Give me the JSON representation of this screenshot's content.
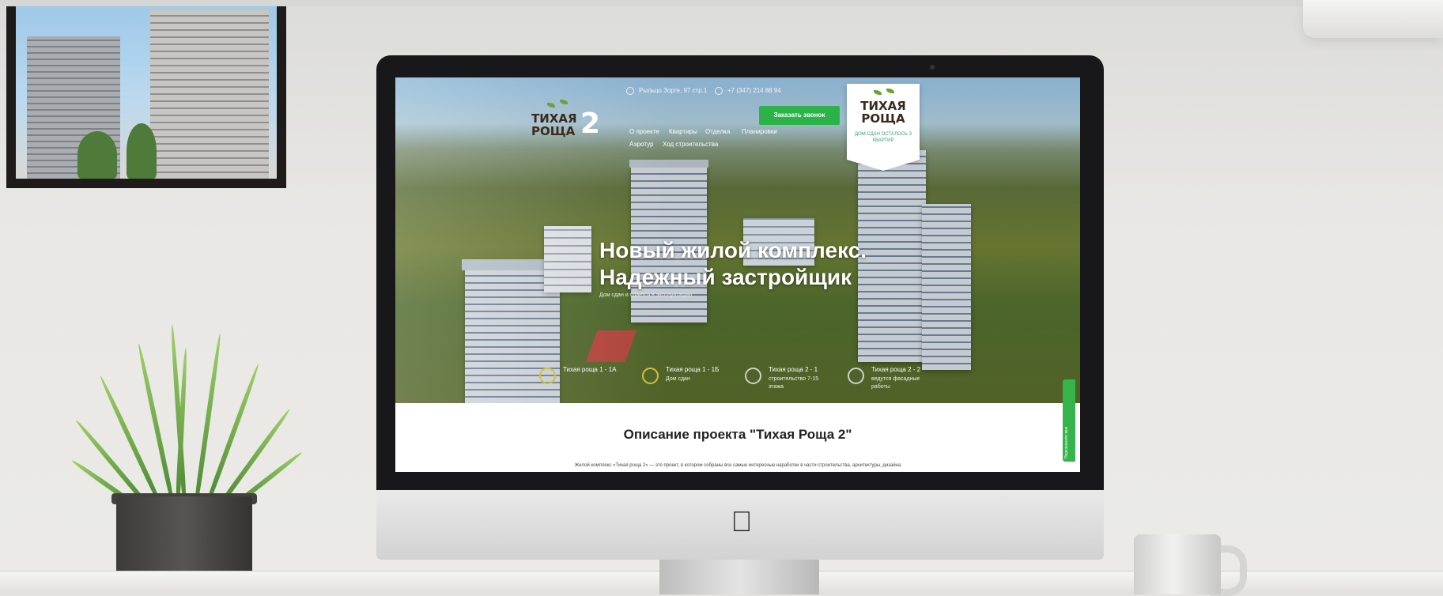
{
  "screen": {
    "topbar": {
      "address": "Рыльцо Зорге, 97 стр.1",
      "phone": "+7 (347) 214 88 94",
      "call_button": "Заказать звонок"
    },
    "logo": {
      "line1": "ТИХАЯ",
      "line2": "РОЩА",
      "number": "2"
    },
    "badge": {
      "line1": "ТИХАЯ",
      "line2": "РОЩА",
      "subtitle": "ДОМ СДАН ОСТАЛОСЬ 3 КВАРТИР"
    },
    "nav": [
      "О проекте",
      "Квартиры",
      "Отделка",
      "Планировки",
      "Аэротур",
      "Ход строительства"
    ],
    "hero": {
      "headline_1": "Новый жилой комплекс.",
      "headline_2": "Надежный застройщик",
      "subline": "Дом сдан и сдается в эксплуатацию"
    },
    "steps": [
      {
        "title": "Тихая роща 1 - 1А",
        "desc": ""
      },
      {
        "title": "Тихая роща 1 - 1Б",
        "desc": "Дом сдан"
      },
      {
        "title": "Тихая роща 2 - 1",
        "desc": "строительство 7-15 этажа"
      },
      {
        "title": "Тихая роща 2 - 2",
        "desc": "ведутся фасадные работы"
      }
    ],
    "side_tab": "Перезвоните мне",
    "description": {
      "title": "Описание проекта \"Тихая Роща 2\"",
      "text": "Жилой комплекс «Тихая роща 2» — это проект, в котором собраны все самые интересные наработки в части строительства, архитектуры, дизайна"
    }
  },
  "colors": {
    "accent_green": "#2bb34a",
    "ring_yellow": "#d1c03c",
    "logo_brown": "#3a2a1e"
  }
}
